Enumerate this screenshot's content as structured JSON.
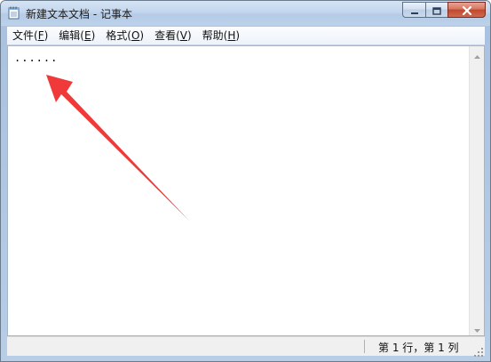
{
  "window": {
    "title": "新建文本文档 - 记事本"
  },
  "menu": {
    "items": [
      {
        "label": "文件(",
        "key": "F",
        "close": ")"
      },
      {
        "label": "编辑(",
        "key": "E",
        "close": ")"
      },
      {
        "label": "格式(",
        "key": "O",
        "close": ")"
      },
      {
        "label": "查看(",
        "key": "V",
        "close": ")"
      },
      {
        "label": "帮助(",
        "key": "H",
        "close": ")"
      }
    ]
  },
  "editor": {
    "content": "......"
  },
  "statusbar": {
    "position": "第 1 行，第 1 列"
  },
  "icons": {
    "app": "notepad-icon",
    "minimize": "minimize-icon",
    "maximize": "maximize-icon",
    "close": "close-icon",
    "annotation": "red-arrow"
  },
  "colors": {
    "arrow": "#f03a3a",
    "close_button": "#c8452e"
  }
}
